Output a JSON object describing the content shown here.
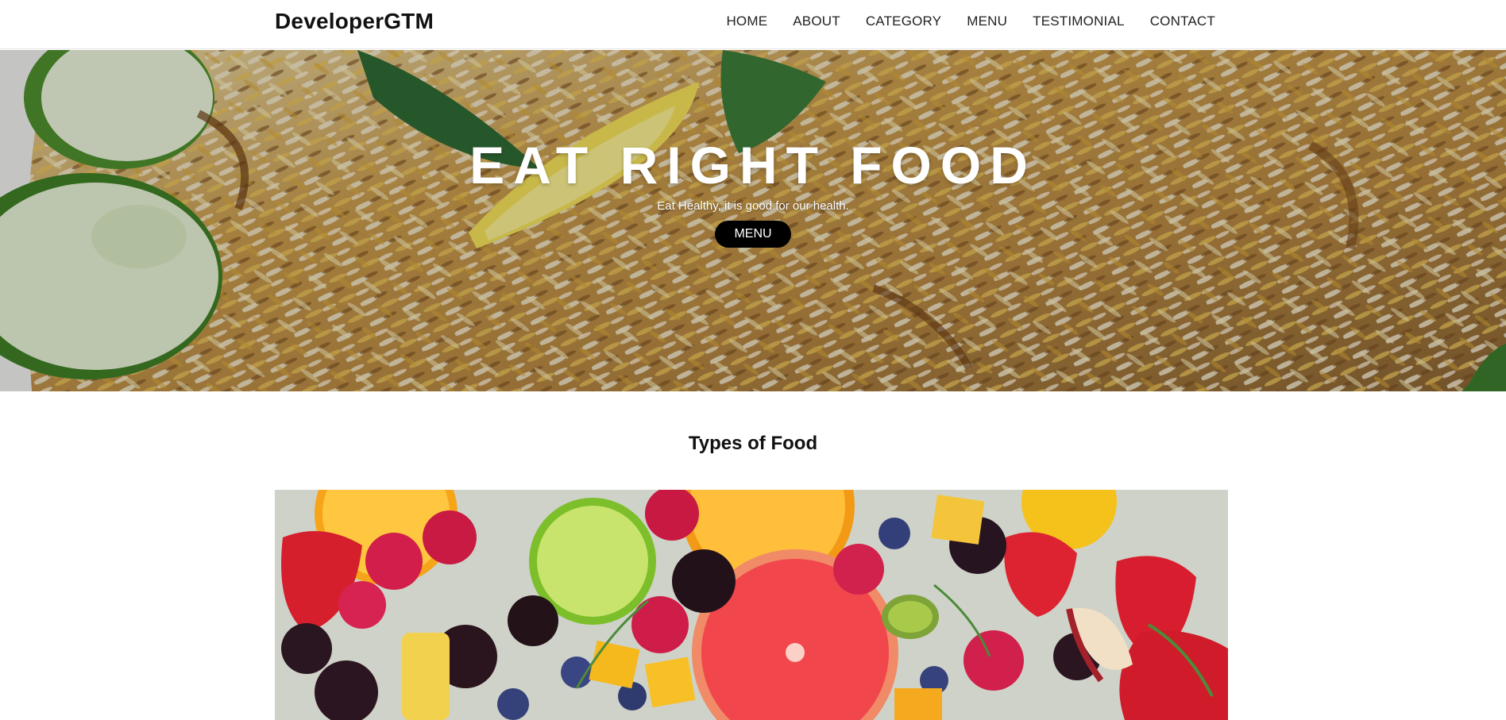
{
  "brand": {
    "name": "DeveloperGTM"
  },
  "nav": {
    "items": [
      {
        "label": "HOME"
      },
      {
        "label": "ABOUT"
      },
      {
        "label": "CATEGORY"
      },
      {
        "label": "MENU"
      },
      {
        "label": "TESTIMONIAL"
      },
      {
        "label": "CONTACT"
      }
    ]
  },
  "hero": {
    "title": "EAT RIGHT FOOD",
    "subtitle": "Eat Healthy, it is good for our health.",
    "button_label": "MENU",
    "image": "biryani-rice-photo"
  },
  "types": {
    "title": "Types of Food",
    "image": "fruit-platter-photo"
  },
  "colors": {
    "nav_bg": "#ffffff",
    "button_bg": "#000000",
    "button_text": "#ffffff",
    "text": "#111111"
  }
}
